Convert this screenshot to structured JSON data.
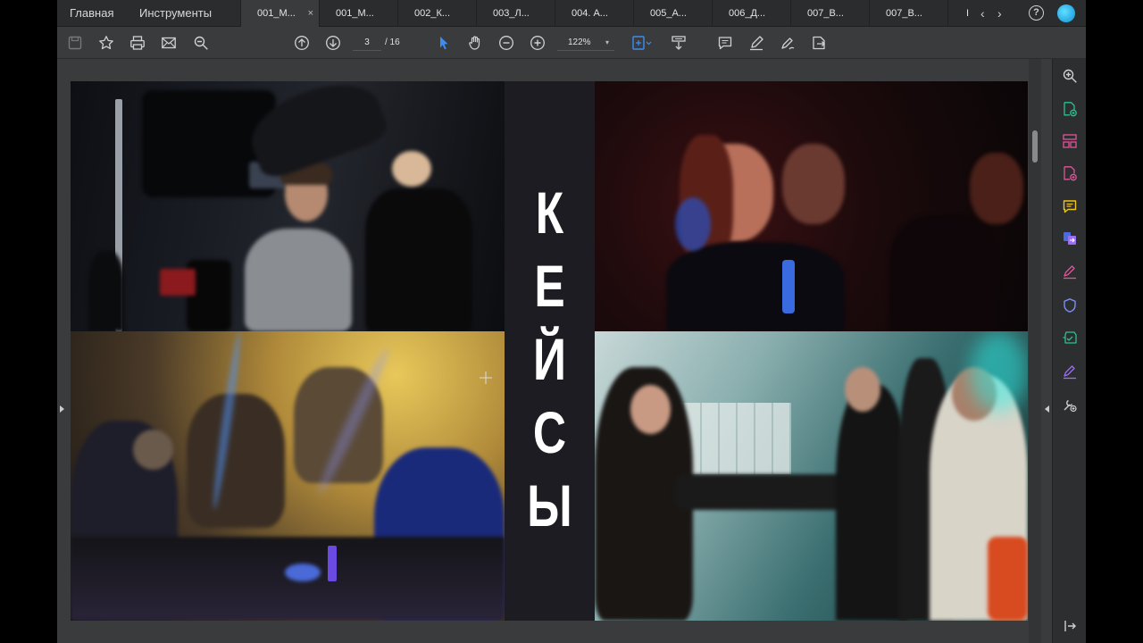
{
  "menu": {
    "home": "Главная",
    "tools": "Инструменты"
  },
  "tabs": [
    {
      "label": "001_М...",
      "close": "×",
      "active": true
    },
    {
      "label": "001_М...",
      "active": false
    },
    {
      "label": "002_К...",
      "active": false
    },
    {
      "label": "003_Л...",
      "active": false
    },
    {
      "label": "004. А...",
      "active": false
    },
    {
      "label": "005_А...",
      "active": false
    },
    {
      "label": "006_Д...",
      "active": false
    },
    {
      "label": "007_В...",
      "active": false
    },
    {
      "label": "007_В...",
      "active": false
    },
    {
      "label": "I",
      "active": false
    }
  ],
  "tab_nav": {
    "prev": "‹",
    "next": "›"
  },
  "help_label": "?",
  "toolbar": {
    "icons": [
      "save-icon",
      "star-icon",
      "print-icon",
      "mail-icon",
      "search-zoom-icon",
      "page-up-icon",
      "page-down-icon",
      "select-arrow-icon",
      "hand-icon",
      "zoom-out-icon",
      "zoom-in-icon",
      "fit-page-icon",
      "scroll-mode-icon",
      "comment-icon",
      "highlight-pen-icon",
      "sign-icon",
      "export-icon"
    ],
    "page_current": "3",
    "page_total": "/ 16",
    "zoom": "122%",
    "zoom_caret": "▾"
  },
  "document": {
    "heading_letters": [
      "К",
      "Е",
      "Й",
      "С",
      "Ы"
    ]
  },
  "right_sidebar": {
    "icons": [
      "zoom-search-icon",
      "create-pdf-icon",
      "organize-pages-icon",
      "edit-pdf-icon",
      "comment-icon",
      "export-pdf-icon",
      "fill-sign-icon",
      "protect-icon",
      "scan-icon",
      "request-signature-icon",
      "more-tools-icon",
      "collapse-panel-icon"
    ]
  },
  "colors": {
    "tabbar_bg": "#2b2c2e",
    "toolbar_bg": "#3a3b3d",
    "page_bg": "#1b1b1f",
    "accent_blue": "#3d8ef2",
    "sidebar_green": "#28c28f",
    "sidebar_pink": "#e0559a",
    "sidebar_yellow": "#f0c419",
    "sidebar_purple": "#9c6ef0"
  }
}
